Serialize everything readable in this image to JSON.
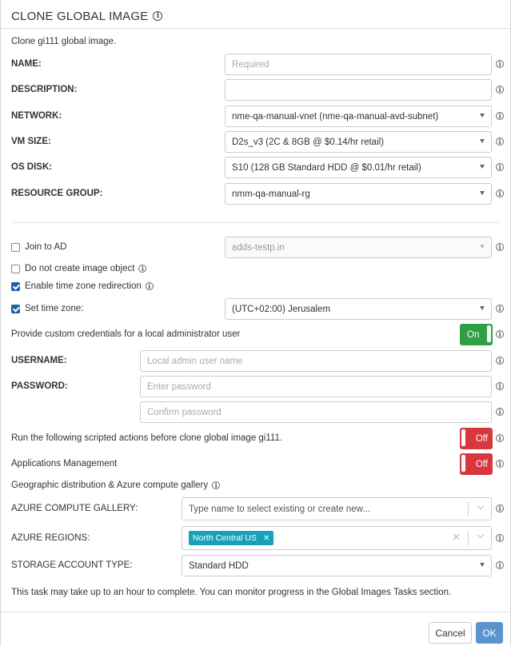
{
  "dialog": {
    "title": "CLONE GLOBAL IMAGE",
    "subtitle": "Clone gi111 global image."
  },
  "fields": {
    "name": {
      "label": "NAME:",
      "placeholder": "Required",
      "value": ""
    },
    "description": {
      "label": "DESCRIPTION:",
      "value": ""
    },
    "network": {
      "label": "NETWORK:",
      "value": "nme-qa-manual-vnet (nme-qa-manual-avd-subnet)"
    },
    "vm_size": {
      "label": "VM SIZE:",
      "value": "D2s_v3 (2C & 8GB @ $0.14/hr retail)"
    },
    "os_disk": {
      "label": "OS DISK:",
      "value": "S10 (128 GB Standard HDD @ $0.01/hr retail)"
    },
    "resource_group": {
      "label": "RESOURCE GROUP:",
      "value": "nmm-qa-manual-rg"
    }
  },
  "options": {
    "join_ad": {
      "label": "Join to AD",
      "checked": false,
      "domain_value": "adds-testp.in"
    },
    "no_image_object": {
      "label": "Do not create image object",
      "checked": false
    },
    "tz_redirect": {
      "label": "Enable time zone redirection",
      "checked": true
    },
    "set_tz": {
      "label": "Set time zone:",
      "checked": true,
      "value": "(UTC+02:00) Jerusalem"
    }
  },
  "credentials": {
    "label": "Provide custom credentials for a local administrator user",
    "toggle": "On",
    "username_label": "USERNAME:",
    "username_placeholder": "Local admin user name",
    "password_label": "PASSWORD:",
    "password_placeholder": "Enter password",
    "confirm_placeholder": "Confirm password"
  },
  "scripted": {
    "label": "Run the following scripted actions before clone global image gi111.",
    "toggle": "Off"
  },
  "apps": {
    "label": "Applications Management",
    "toggle": "Off"
  },
  "gallery": {
    "section_label": "Geographic distribution & Azure compute gallery",
    "gallery_label": "AZURE COMPUTE GALLERY:",
    "gallery_placeholder": "Type name to select existing or create new...",
    "regions_label": "AZURE REGIONS:",
    "region_tag": "North Central US",
    "storage_label": "STORAGE ACCOUNT TYPE:",
    "storage_value": "Standard HDD"
  },
  "note": "This task may take up to an hour to complete. You can monitor progress in the Global Images Tasks section.",
  "footer": {
    "cancel": "Cancel",
    "ok": "OK"
  },
  "icons": {
    "info": "info-icon",
    "caret": "caret-down-icon",
    "chevron": "chevron-down-icon",
    "clear": "clear-icon",
    "check": "check-icon"
  },
  "colors": {
    "primary": "#1c5fa8",
    "on": "#2ea043",
    "off": "#d9363e",
    "tag": "#17a2b8",
    "ok_button": "#5b93cd"
  }
}
